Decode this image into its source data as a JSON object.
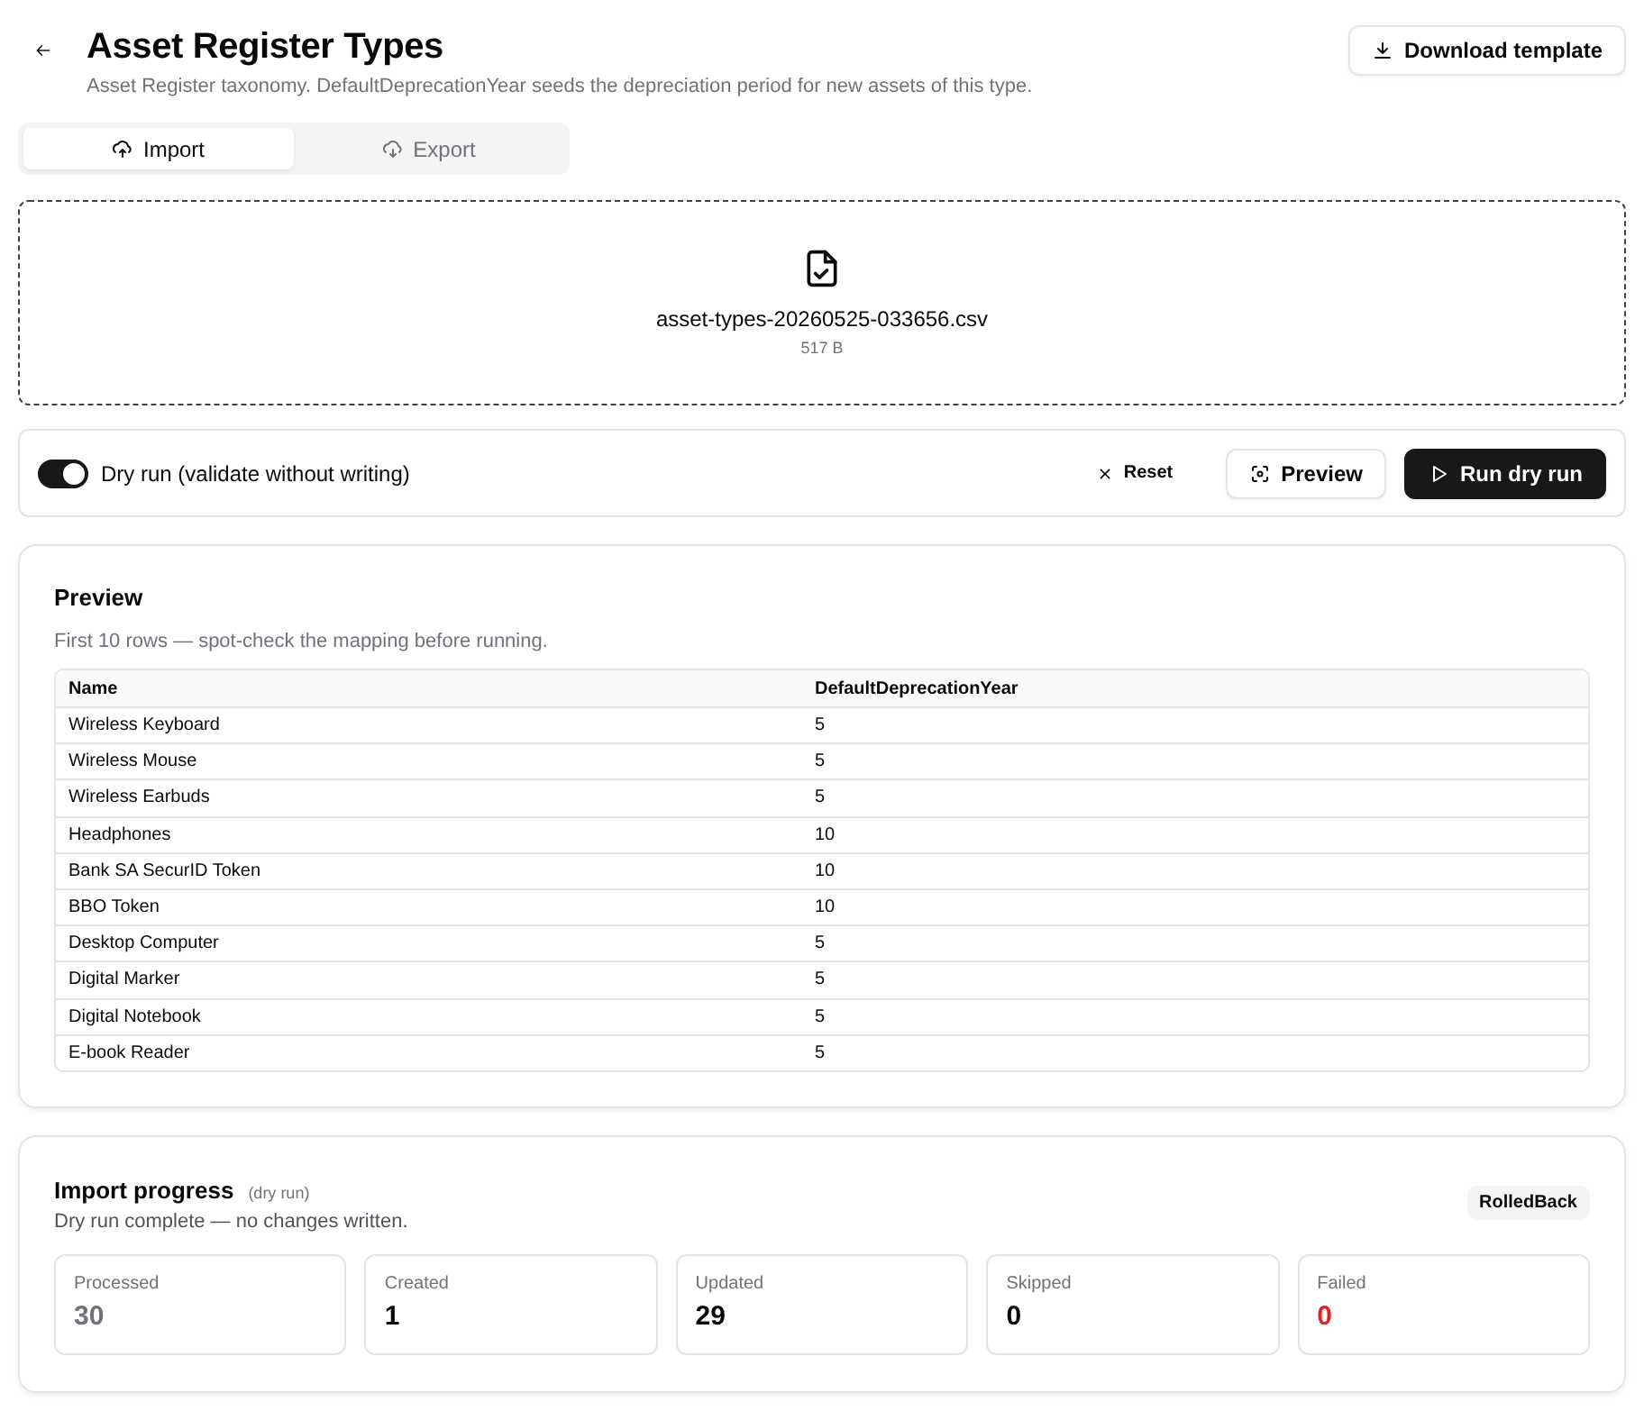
{
  "header": {
    "title": "Asset Register Types",
    "subtitle": "Asset Register taxonomy. DefaultDeprecationYear seeds the depreciation period for new assets of this type.",
    "download_button": "Download template"
  },
  "tabs": [
    {
      "label": "Import",
      "selected": true
    },
    {
      "label": "Export",
      "selected": false
    }
  ],
  "dropzone": {
    "filename": "asset-types-20260525-033656.csv",
    "size": "517 B"
  },
  "controls": {
    "dry_run": {
      "label": "Dry run (validate without writing)",
      "on": true
    },
    "reset_button": "Reset",
    "preview_button": "Preview",
    "run_button": "Run dry run"
  },
  "preview": {
    "title": "Preview",
    "subtitle": "First 10 rows — spot-check the mapping before running.",
    "table": {
      "columns": [
        "Name",
        "DefaultDeprecationYear"
      ],
      "rows": [
        [
          "Wireless Keyboard",
          "5"
        ],
        [
          "Wireless Mouse",
          "5"
        ],
        [
          "Wireless Earbuds",
          "5"
        ],
        [
          "Headphones",
          "10"
        ],
        [
          "Bank SA SecurID Token",
          "10"
        ],
        [
          "BBO Token",
          "10"
        ],
        [
          "Desktop Computer",
          "5"
        ],
        [
          "Digital Marker",
          "5"
        ],
        [
          "Digital Notebook",
          "5"
        ],
        [
          "E-book Reader",
          "5"
        ]
      ]
    }
  },
  "progress": {
    "title": "Import progress",
    "mode": "(dry run)",
    "message": "Dry run complete — no changes written.",
    "status": "RolledBack",
    "stats": [
      {
        "label": "Processed",
        "value": "30",
        "color": "#71717a"
      },
      {
        "label": "Created",
        "value": "1",
        "color": "#09090b"
      },
      {
        "label": "Updated",
        "value": "29",
        "color": "#09090b"
      },
      {
        "label": "Skipped",
        "value": "0",
        "color": "#09090b"
      },
      {
        "label": "Failed",
        "value": "0",
        "color": "#dc2626"
      }
    ]
  }
}
